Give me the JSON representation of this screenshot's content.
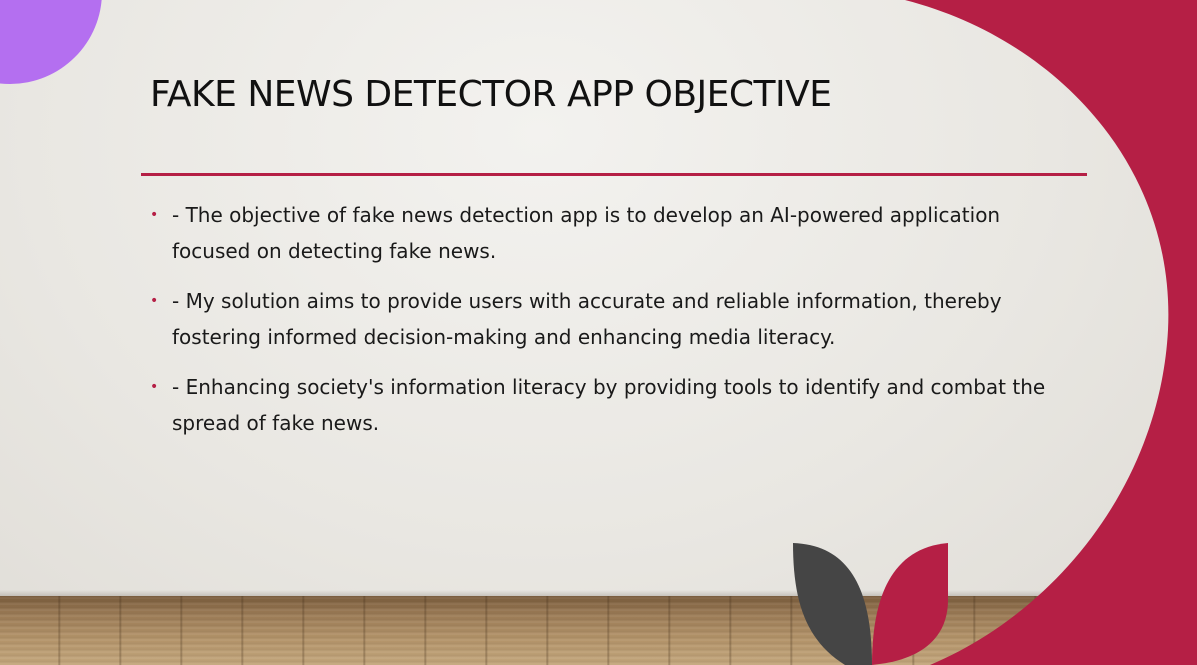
{
  "slide": {
    "title": "FAKE NEWS DETECTOR APP OBJECTIVE",
    "bullet_marker": "•",
    "bullets": [
      "- The objective of fake news detection app is to develop an AI-powered application focused on detecting fake news.",
      "- My solution aims to provide users with accurate and reliable information, thereby fostering informed decision-making and enhancing media literacy.",
      "- Enhancing society's information literacy by providing tools to identify and combat the spread of fake news."
    ]
  },
  "colors": {
    "accent": "#b51f45",
    "purple": "#b46ff0",
    "dark_leaf": "#454545",
    "background": "#ebe9e4"
  }
}
